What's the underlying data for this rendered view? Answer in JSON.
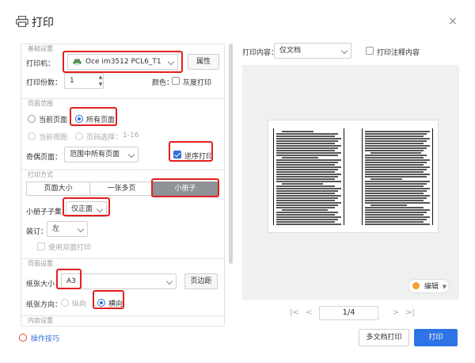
{
  "window": {
    "title": "打印",
    "close_label": "×"
  },
  "basic": {
    "section_title": "基础设置",
    "printer_label": "打印机：",
    "printer_value": "Oce im3512 PCL6_T1",
    "properties_label": "属性",
    "copies_label": "打印份数：",
    "copies_value": "1",
    "color_label": "颜色：",
    "grayscale_label": "灰度打印"
  },
  "range": {
    "section_title": "页面范围",
    "current_page": "当前页面",
    "all_pages": "所有页面",
    "current_view": "当前视图",
    "page_select_label": "页码选择：",
    "page_select_placeholder": "1-16",
    "odd_even_label": "奇偶页面：",
    "odd_even_value": "范围中所有页面",
    "reverse_label": "逆序打印"
  },
  "mode": {
    "section_title": "打印方式",
    "tabs": [
      "页面大小",
      "一张多页",
      "小册子"
    ],
    "booklet_subset_label": "小册子子集：",
    "booklet_subset_value": "仅正面",
    "binding_label": "装订：",
    "binding_value": "左",
    "duplex_label": "使用双面打印"
  },
  "page": {
    "section_title": "页面设置",
    "paper_size_label": "纸张大小：",
    "paper_size_value": "A3",
    "margins_label": "页边距",
    "orientation_label": "纸张方向：",
    "portrait_label": "纵向",
    "landscape_label": "横向"
  },
  "content": {
    "section_title": "内容设置"
  },
  "tips_label": "操作技巧",
  "preview": {
    "content_label": "打印内容：",
    "content_value": "仅文档",
    "annotations_label": "打印注释内容",
    "edit_label": "编辑",
    "page_indicator": "1/4"
  },
  "footer": {
    "multi_print_label": "多文档打印",
    "print_label": "打印"
  },
  "colors": {
    "accent": "#2f74e6",
    "highlight_red": "#e41f1f",
    "selected_tab": "#8f9296"
  }
}
